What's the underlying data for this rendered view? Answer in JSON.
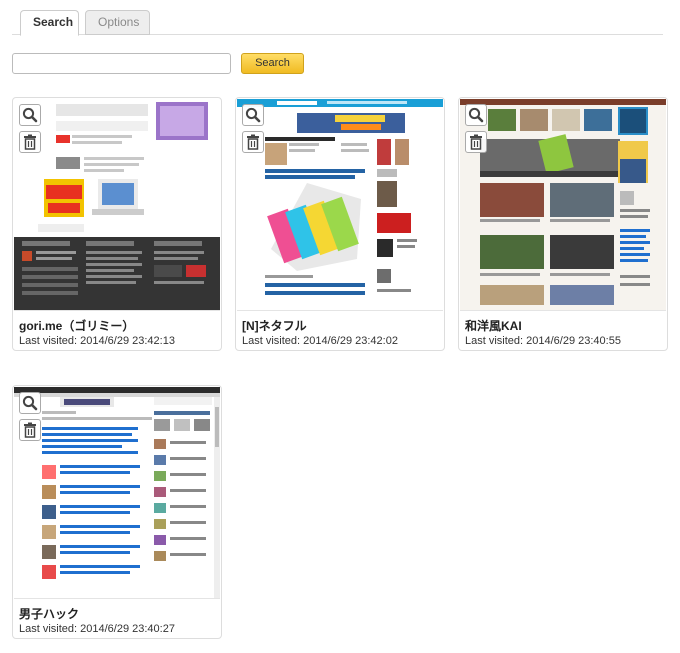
{
  "tabs": [
    {
      "label": "Search",
      "active": true
    },
    {
      "label": "Options",
      "active": false
    }
  ],
  "search": {
    "value": "",
    "placeholder": "",
    "button_label": "Search"
  },
  "colors": {
    "button_bg": "#f0bb22",
    "tab_inactive_bg": "#eeeeee",
    "card_border": "#dddddd"
  },
  "cards": [
    {
      "title": "gori.me（ゴリミー）",
      "visited": "Last visited: 2014/6/29 23:42:13",
      "preview": "dark-site",
      "icons": [
        "zoom-icon",
        "trash-icon"
      ]
    },
    {
      "title": "[N]ネタフル",
      "visited": "Last visited: 2014/6/29 23:42:02",
      "preview": "blue-header-site",
      "icons": [
        "zoom-icon",
        "trash-icon"
      ]
    },
    {
      "title": "和洋風KAI",
      "visited": "Last visited: 2014/6/29 23:40:55",
      "preview": "photo-grid-site",
      "icons": [
        "zoom-icon",
        "trash-icon"
      ]
    },
    {
      "title": "男子ハック",
      "visited": "Last visited: 2014/6/29 23:40:27",
      "preview": "list-site",
      "icons": [
        "zoom-icon",
        "trash-icon"
      ]
    }
  ]
}
